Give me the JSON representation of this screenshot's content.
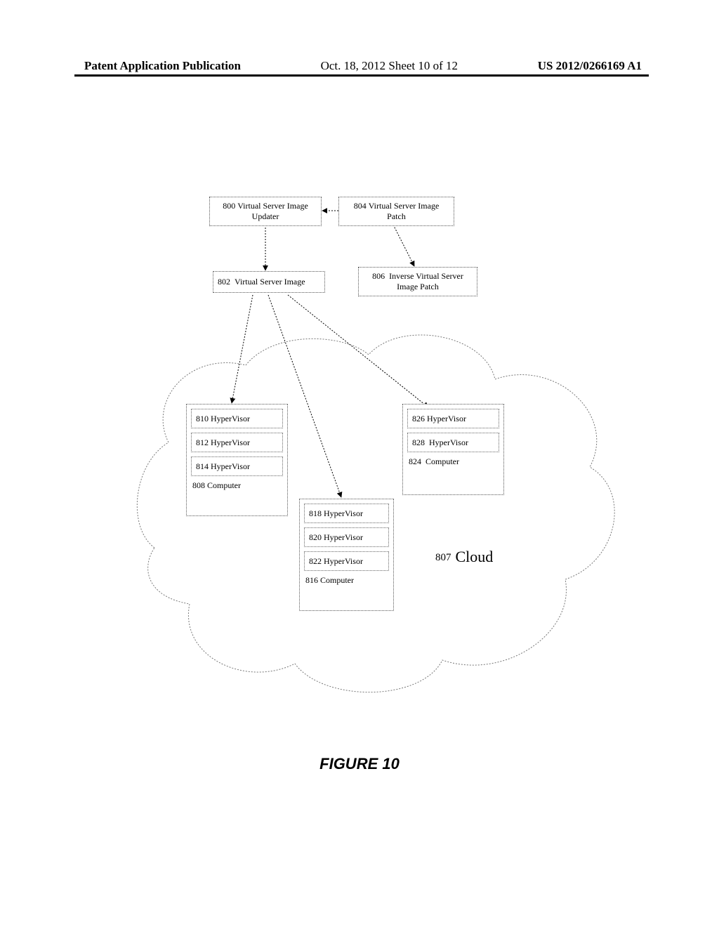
{
  "header": {
    "left": "Patent Application Publication",
    "center": "Oct. 18, 2012  Sheet 10 of 12",
    "right": "US 2012/0266169 A1"
  },
  "boxes": {
    "b800": {
      "num": "800",
      "label": "Virtual Server Image Updater"
    },
    "b804": {
      "num": "804",
      "label": "Virtual Server Image Patch"
    },
    "b802": {
      "num": "802",
      "label": "Virtual Server Image"
    },
    "b806": {
      "num": "806",
      "label": "Inverse Virtual Server Image Patch"
    },
    "b810": {
      "num": "810",
      "label": "HyperVisor"
    },
    "b812": {
      "num": "812",
      "label": "HyperVisor"
    },
    "b814": {
      "num": "814",
      "label": "HyperVisor"
    },
    "b808": {
      "num": "808",
      "label": "Computer"
    },
    "b818": {
      "num": "818",
      "label": "HyperVisor"
    },
    "b820": {
      "num": "820",
      "label": "HyperVisor"
    },
    "b822": {
      "num": "822",
      "label": "HyperVisor"
    },
    "b816": {
      "num": "816",
      "label": "Computer"
    },
    "b826": {
      "num": "826",
      "label": "HyperVisor"
    },
    "b828": {
      "num": "828",
      "label": "HyperVisor"
    },
    "b824": {
      "num": "824",
      "label": "Computer"
    },
    "b807": {
      "num": "807",
      "label": "Cloud"
    }
  },
  "caption": "FIGURE 10"
}
